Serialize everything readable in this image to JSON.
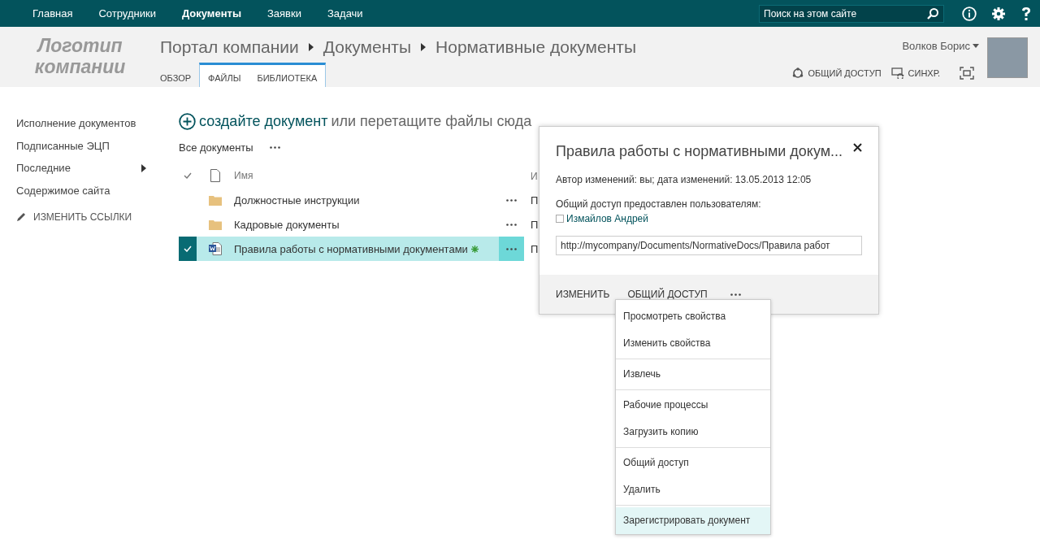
{
  "top_nav": {
    "items": [
      {
        "label": "Главная",
        "selected": false
      },
      {
        "label": "Сотрудники",
        "selected": false
      },
      {
        "label": "Документы",
        "selected": true
      },
      {
        "label": "Заявки",
        "selected": false
      },
      {
        "label": "Задачи",
        "selected": false
      }
    ],
    "search": {
      "placeholder": "Поиск на этом сайте"
    }
  },
  "header": {
    "logo": [
      "Логотип",
      "компании"
    ],
    "breadcrumb": [
      "Портал компании",
      "Документы",
      "Нормативные документы"
    ],
    "tabs": [
      {
        "label": "ОБЗОР",
        "selected": false
      },
      {
        "label": "ФАЙЛЫ",
        "selected": true
      },
      {
        "label": "БИБЛИОТЕКА",
        "selected": true
      }
    ],
    "user": "Волков Борис",
    "actions": [
      {
        "label": "ОБЩИЙ ДОСТУП",
        "kind": "share"
      },
      {
        "label": "СИНХР.",
        "kind": "sync"
      },
      {
        "kind": "focus"
      }
    ]
  },
  "sidebar": {
    "items": [
      {
        "label": "Исполнение документов",
        "submenu": false
      },
      {
        "label": "Подписанные ЭЦП",
        "submenu": false
      },
      {
        "label": "Последние",
        "submenu": true
      },
      {
        "label": "Содержимое сайта",
        "submenu": false
      }
    ],
    "edit_links": "ИЗМЕНИТЬ ССЫЛКИ"
  },
  "library": {
    "create_link": "создайте документ",
    "create_rest": "или перетащите файлы сюда",
    "view": "Все документы",
    "columns": {
      "name": "Имя",
      "column_3": "И"
    },
    "rows": [
      {
        "name": "Должностные инструкции",
        "kind": "folder",
        "selected": false,
        "new": false,
        "column_3": "П"
      },
      {
        "name": "Кадровые документы",
        "kind": "folder",
        "selected": false,
        "new": false,
        "column_3": "П"
      },
      {
        "name": "Правила работы с нормативными документами",
        "kind": "word",
        "selected": true,
        "new": true,
        "column_3": "П"
      }
    ]
  },
  "callout": {
    "title": "Правила работы с нормативными докум...",
    "modified": "Автор изменений: вы; дата изменений: 13.05.2013 12:05",
    "shared_label": "Общий доступ предоставлен пользователям:",
    "shared_users": [
      "Измайлов Андрей"
    ],
    "url": "http://mycompany/Documents/NormativeDocs/Правила работ",
    "actions": [
      "ИЗМЕНИТЬ",
      "ОБЩИЙ ДОСТУП"
    ]
  },
  "menu": {
    "groups": [
      [
        {
          "label": "Просмотреть свойства",
          "highlighted": false
        },
        {
          "label": "Изменить свойства",
          "highlighted": false
        }
      ],
      [
        {
          "label": "Извлечь",
          "highlighted": false
        }
      ],
      [
        {
          "label": "Рабочие процессы",
          "highlighted": false
        },
        {
          "label": "Загрузить копию",
          "highlighted": false
        }
      ],
      [
        {
          "label": "Общий доступ",
          "highlighted": false
        },
        {
          "label": "Удалить",
          "highlighted": false
        }
      ],
      [
        {
          "label": "Зарегистрировать документ",
          "highlighted": true
        }
      ]
    ]
  }
}
